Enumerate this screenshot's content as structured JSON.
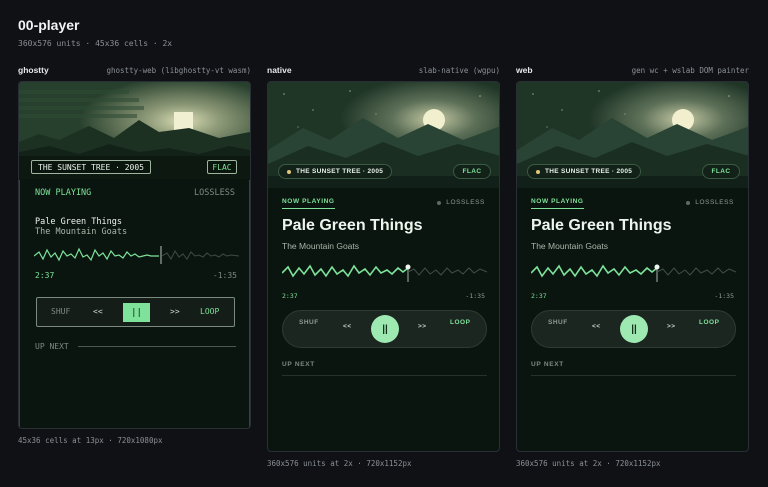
{
  "page": {
    "title": "00-player",
    "subtitle": "360x576 units · 45x36 cells · 2x"
  },
  "columns": [
    {
      "name": "ghostty",
      "desc": "ghostty-web (libghostty-vt wasm)",
      "caption": "45x36 cells at 13px · 720x1080px"
    },
    {
      "name": "native",
      "desc": "slab-native (wgpu)",
      "caption": "360x576 units at 2x · 720x1152px"
    },
    {
      "name": "web",
      "desc": "gen wc + wslab DOM painter",
      "caption": "360x576 units at 2x · 720x1152px"
    }
  ],
  "player": {
    "album": "THE SUNSET TREE · 2005",
    "format": "FLAC",
    "now_playing": "NOW PLAYING",
    "lossless": "LOSSLESS",
    "song": "Pale Green Things",
    "artist": "The Mountain Goats",
    "elapsed": "2:37",
    "remaining": "-1:35",
    "progress": 0.62,
    "shuffle": "SHUF",
    "prev": "<<",
    "pause_glyph": "||",
    "next": ">>",
    "loop": "LOOP",
    "up_next": "UP NEXT",
    "ghostty_wave": "\\y/ y/-//-\\y'-\\y/\\—\\y'\\—",
    "colors": {
      "accent": "#7ee29a",
      "background": "#0b150f",
      "sky": "#1f3526"
    }
  }
}
